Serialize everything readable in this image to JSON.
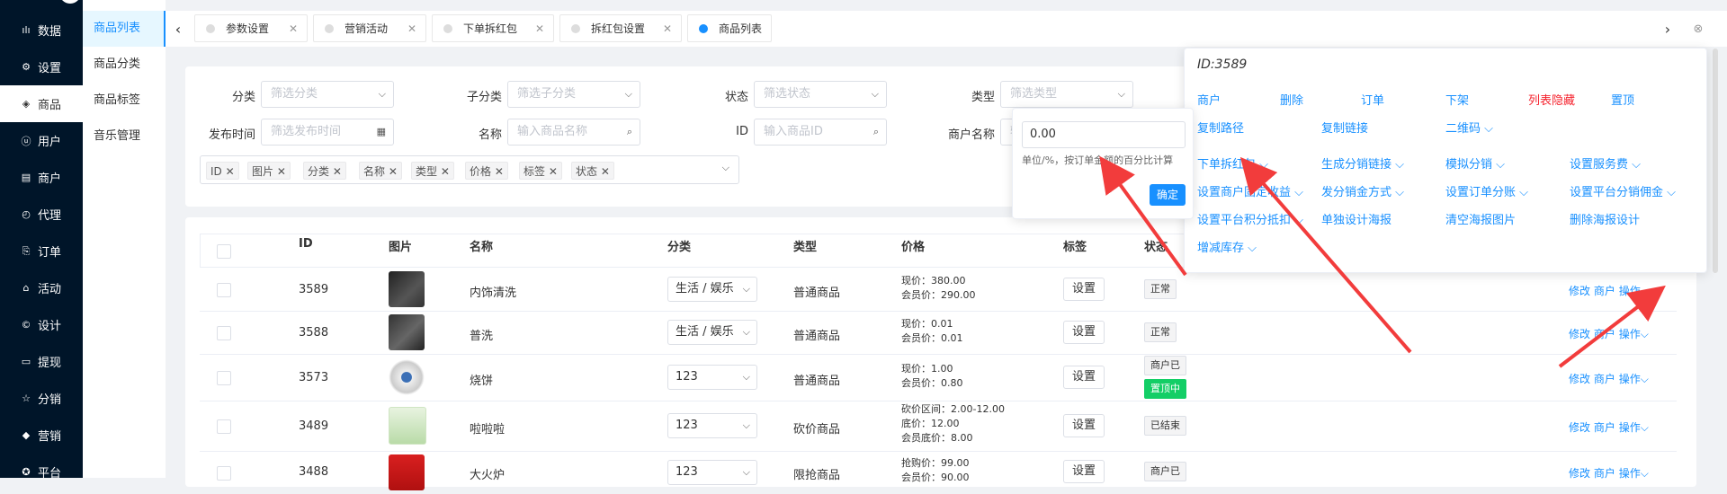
{
  "sidebar": {
    "items": [
      {
        "icon": "chart-icon",
        "label": "数据"
      },
      {
        "icon": "gear-icon",
        "label": "设置"
      },
      {
        "icon": "cube-icon",
        "label": "商品"
      },
      {
        "icon": "user-icon",
        "label": "用户"
      },
      {
        "icon": "shop-icon",
        "label": "商户"
      },
      {
        "icon": "agent-icon",
        "label": "代理"
      },
      {
        "icon": "order-icon",
        "label": "订单"
      },
      {
        "icon": "tag-icon",
        "label": "活动"
      },
      {
        "icon": "design-icon",
        "label": "设计"
      },
      {
        "icon": "withdraw-icon",
        "label": "提现"
      },
      {
        "icon": "star-icon",
        "label": "分销"
      },
      {
        "icon": "marketing-icon",
        "label": "营销"
      },
      {
        "icon": "platform-icon",
        "label": "平台"
      }
    ]
  },
  "submenu": {
    "items": [
      "商品列表",
      "商品分类",
      "商品标签",
      "音乐管理"
    ]
  },
  "tabs": [
    {
      "label": "参数设置"
    },
    {
      "label": "营销活动"
    },
    {
      "label": "下单拆红包"
    },
    {
      "label": "拆红包设置"
    },
    {
      "label": "商品列表"
    }
  ],
  "filters": {
    "row1": [
      {
        "label": "分类",
        "placeholder": "筛选分类"
      },
      {
        "label": "子分类",
        "placeholder": "筛选子分类"
      },
      {
        "label": "状态",
        "placeholder": "筛选状态"
      },
      {
        "label": "类型",
        "placeholder": "筛选类型"
      }
    ],
    "row2": [
      {
        "label": "发布时间",
        "placeholder": "筛选发布时间"
      },
      {
        "label": "名称",
        "placeholder": "输入商品名称"
      },
      {
        "label": "ID",
        "placeholder": "输入商品ID"
      },
      {
        "label": "商户名称",
        "placeholder": "输"
      }
    ],
    "columns_tags": [
      "ID",
      "图片",
      "分类",
      "名称",
      "类型",
      "价格",
      "标签",
      "状态"
    ]
  },
  "table": {
    "headers": [
      "ID",
      "图片",
      "名称",
      "分类",
      "类型",
      "价格",
      "标签",
      "状态"
    ],
    "set_label": "设置",
    "ops": {
      "edit": "修改",
      "shop": "商户",
      "more": "操作"
    },
    "rows": [
      {
        "id": "3589",
        "name": "内饰清洗",
        "category": "生活 / 娱乐",
        "type": "普通商品",
        "price": [
          "现价：380.00",
          "会员价：290.00"
        ],
        "status": [
          "正常"
        ]
      },
      {
        "id": "3588",
        "name": "普洗",
        "category": "生活 / 娱乐",
        "type": "普通商品",
        "price": [
          "现价：0.01",
          "会员价：0.01"
        ],
        "status": [
          "正常"
        ]
      },
      {
        "id": "3573",
        "name": "烧饼",
        "category": "123",
        "type": "普通商品",
        "price": [
          "现价：1.00",
          "会员价：0.80"
        ],
        "status": [
          "商户已",
          "置顶中"
        ]
      },
      {
        "id": "3489",
        "name": "啦啦啦",
        "category": "123",
        "type": "砍价商品",
        "price": [
          "砍价区间：2.00-12.00",
          "底价：12.00",
          "会员底价：8.00"
        ],
        "status": [
          "已结束"
        ]
      },
      {
        "id": "3488",
        "name": "大火炉",
        "category": "123",
        "type": "限抢商品",
        "price": [
          "抢购价：99.00",
          "会员价：90.00"
        ],
        "status": [
          "商户已"
        ]
      }
    ]
  },
  "popover": {
    "title": "ID:3589",
    "row1": [
      "商户",
      "删除",
      "订单",
      "下架",
      "列表隐藏",
      "置顶"
    ],
    "row2": [
      "复制路径",
      "复制链接",
      "二维码"
    ],
    "row3": [
      "下单拆红包",
      "生成分销链接",
      "模拟分销",
      "设置服务费"
    ],
    "row4": [
      "设置商户固定收益",
      "发分销金方式",
      "设置订单分账",
      "设置平台分销佣金"
    ],
    "row5": [
      "设置平台积分抵扣",
      "单独设计海报",
      "清空海报图片",
      "删除海报设计"
    ],
    "row6": [
      "增减库存"
    ]
  },
  "red_packet": {
    "value": "0.00",
    "hint": "单位/%，按订单金额的百分比计算",
    "confirm": "确定"
  },
  "colors": {
    "accent": "#1890ff",
    "sidebar": "#001529",
    "danger": "#f5222d",
    "success": "#13ce66"
  }
}
